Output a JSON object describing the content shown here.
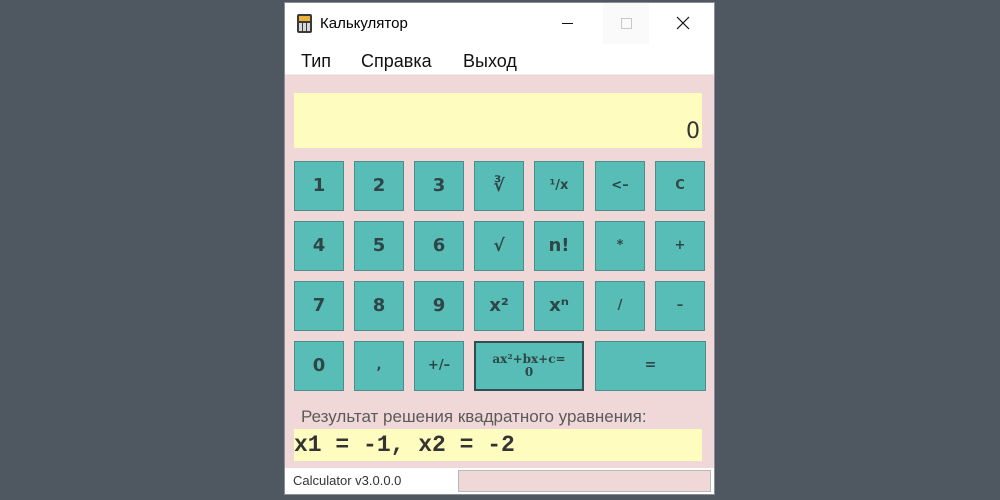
{
  "window": {
    "title": "Калькулятор"
  },
  "menu": {
    "items": [
      "Тип",
      "Справка",
      "Выход"
    ]
  },
  "display": {
    "value": "0"
  },
  "keypad": {
    "row1": [
      "1",
      "2",
      "3",
      "∛",
      "¹/x",
      "<–",
      "C"
    ],
    "row2": [
      "4",
      "5",
      "6",
      "√",
      "n!",
      "*",
      "+"
    ],
    "row3": [
      "7",
      "8",
      "9",
      "x²",
      "xⁿ",
      "/",
      "–"
    ],
    "row4": [
      "0",
      ",",
      "+/–",
      "ax²+bx+c=\n0",
      "="
    ]
  },
  "result": {
    "label": "Результат решения квадратного уравнения:",
    "value": "x1 = -1, x2 = -2"
  },
  "status": {
    "text": "Calculator v3.0.0.0"
  },
  "colors": {
    "background": "#4f5861",
    "window": "#f1d8d8",
    "button": "#58bdb7",
    "display": "#fffcc0"
  }
}
